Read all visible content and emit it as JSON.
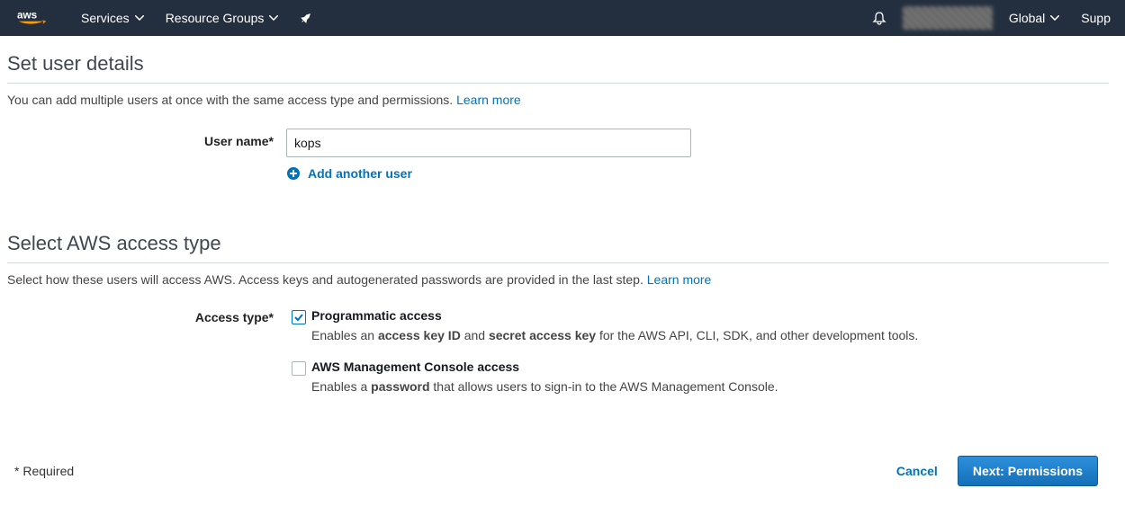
{
  "nav": {
    "services": "Services",
    "resource_groups": "Resource Groups",
    "region": "Global",
    "support": "Supp"
  },
  "section1": {
    "title": "Set user details",
    "desc": "You can add multiple users at once with the same access type and permissions.",
    "learn_more": "Learn more",
    "username_label": "User name*",
    "username_value": "kops",
    "add_another": "Add another user"
  },
  "section2": {
    "title": "Select AWS access type",
    "desc": "Select how these users will access AWS. Access keys and autogenerated passwords are provided in the last step.",
    "learn_more": "Learn more",
    "access_type_label": "Access type*",
    "option1": {
      "title": "Programmatic access",
      "desc_pre": "Enables an ",
      "desc_b1": "access key ID",
      "desc_mid": " and ",
      "desc_b2": "secret access key",
      "desc_post": " for the AWS API, CLI, SDK, and other development tools.",
      "checked": true
    },
    "option2": {
      "title": "AWS Management Console access",
      "desc_pre": "Enables a ",
      "desc_b1": "password",
      "desc_post": " that allows users to sign-in to the AWS Management Console.",
      "checked": false
    }
  },
  "footer": {
    "required": "* Required",
    "cancel": "Cancel",
    "next": "Next: Permissions"
  }
}
